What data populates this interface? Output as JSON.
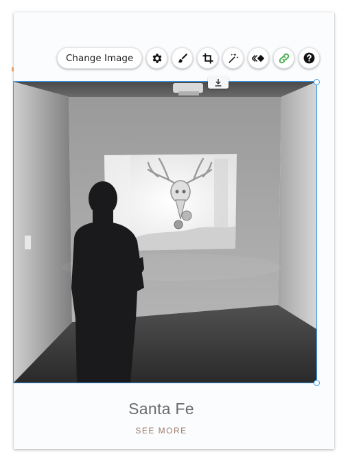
{
  "toolbar": {
    "change_image_label": "Change Image",
    "icons": [
      "gear-icon",
      "brush-icon",
      "crop-icon",
      "magic-wand-icon",
      "animation-icon",
      "link-icon",
      "help-icon"
    ]
  },
  "colors": {
    "selection": "#3899ec",
    "link_icon": "#4caf50",
    "see_more": "#9a7b6a"
  },
  "gallery_item": {
    "title": "Santa Fe",
    "see_more_label": "SEE MORE"
  }
}
